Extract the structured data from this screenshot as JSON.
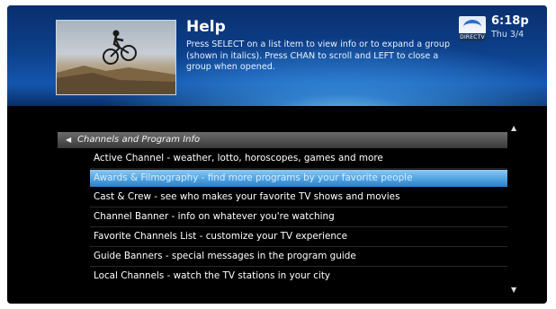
{
  "header": {
    "title": "Help",
    "description": "Press SELECT on a list item to view info or to expand a group (shown in italics). Press CHAN to scroll and LEFT to close a group when opened.",
    "logo_text": "DIRECTV",
    "time": "6:18p",
    "date": "Thu 3/4"
  },
  "list": {
    "group_label": "Channels and Program Info",
    "selected_index": 1,
    "items": [
      "Active Channel - weather, lotto, horoscopes, games and more",
      "Awards & Filmography - find more programs by your favorite people",
      "Cast & Crew - see who makes your favorite TV shows and movies",
      "Channel Banner - info on whatever you're watching",
      "Favorite Channels List - customize your TV experience",
      "Guide Banners - special messages in the program guide",
      "Local Channels - watch the TV stations in your city"
    ],
    "scroll_up": "▲",
    "scroll_down": "▼",
    "collapse_arrow": "◀"
  },
  "icons": {
    "thumbnail": "bmx-rider-photo",
    "logo": "directv-logo"
  },
  "colors": {
    "header_blue": "#0d3f8a",
    "selection_blue": "#4ea2e0",
    "background": "#000000"
  }
}
